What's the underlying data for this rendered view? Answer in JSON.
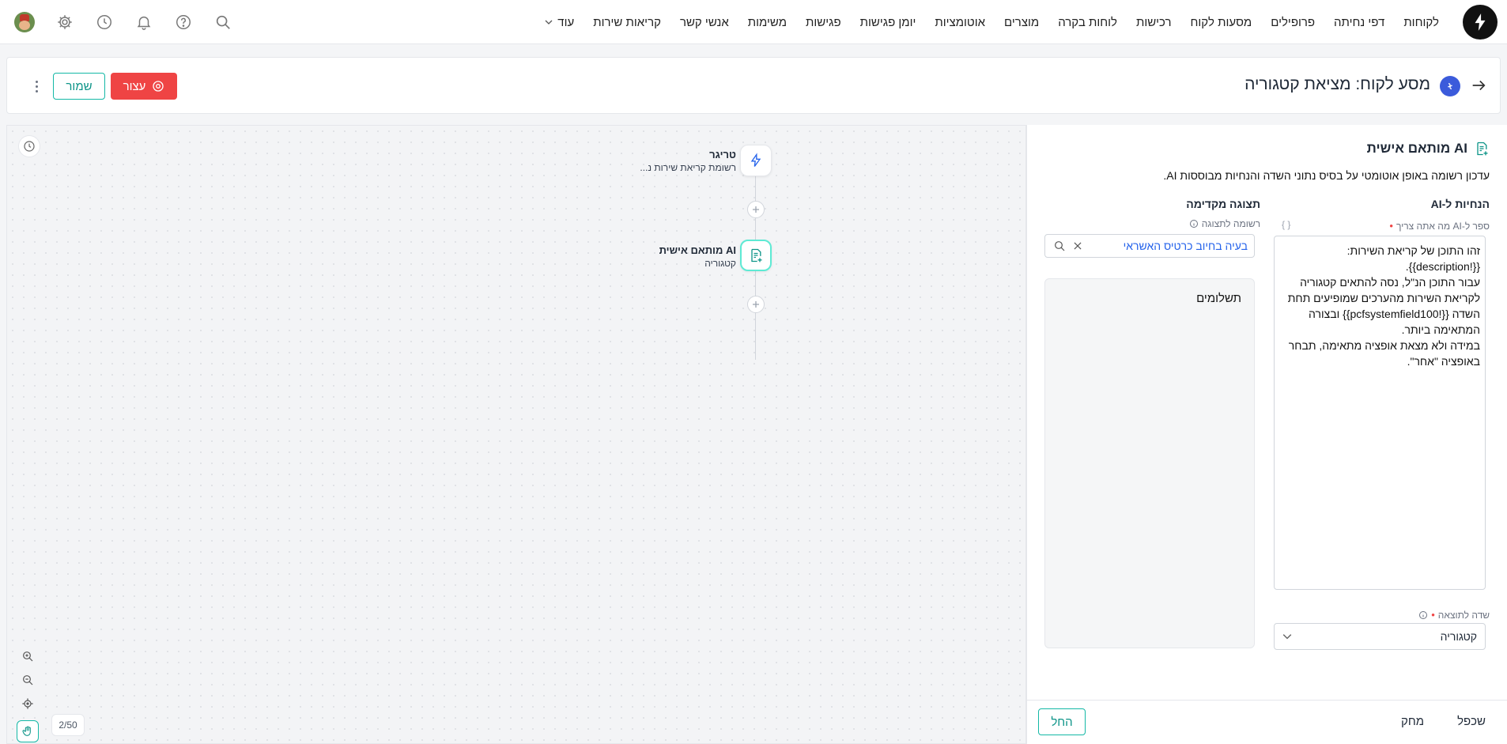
{
  "nav": {
    "items": [
      "לקוחות",
      "דפי נחיתה",
      "פרופילים",
      "מסעות לקוח",
      "רכישות",
      "לוחות בקרה",
      "מוצרים",
      "אוטומציות",
      "יומן פגישות",
      "פגישות",
      "משימות",
      "אנשי קשר",
      "קריאות שירות"
    ],
    "more_label": "עוד"
  },
  "header": {
    "title": "מסע לקוח: מציאת קטגוריה",
    "stop_label": "עצור",
    "save_label": "שמור"
  },
  "flow": {
    "trigger": {
      "title": "טריגר",
      "subtitle": "רשומת קריאת שירות נ..."
    },
    "ai_node": {
      "title": "AI מותאם אישית",
      "subtitle": "קטגוריה"
    },
    "page_count": "2/50"
  },
  "panel": {
    "title": "AI מותאם אישית",
    "description": "עדכון רשומה באופן אוטומטי על בסיס נתוני השדה והנחיות מבוססות AI.",
    "instructions_heading": "הנחיות ל-AI",
    "instructions_sublabel": "ספר ל-AI מה אתה צריך",
    "braces": "{ }",
    "instructions_lines": [
      "זהו התוכן של קריאת השירות:",
      "{{!description}}.",
      "עבור התוכן הנ\"ל, נסה להתאים קטגוריה לקריאת השירות מהערכים שמופיעים תחת השדה {{!pcfsystemfield100}} ובצורה המתאימה ביותר.",
      "במידה ולא מצאת אופציה מתאימה, תבחר באופציה \"אחר\"."
    ],
    "preview_heading": "תצוגה מקדימה",
    "preview_sublabel": "רשומה לתצוגה",
    "preview_search_value": "בעיה בחיוב כרטיס האשראי",
    "preview_result": "תשלומים",
    "output_field_label": "שדה לתוצאה",
    "output_field_value": "קטגוריה",
    "run_label": "החל",
    "delete_label": "מחק",
    "duplicate_label": "שכפל"
  },
  "colors": {
    "accent": "#14b8a6",
    "danger": "#ef4444",
    "link": "#2563eb"
  }
}
